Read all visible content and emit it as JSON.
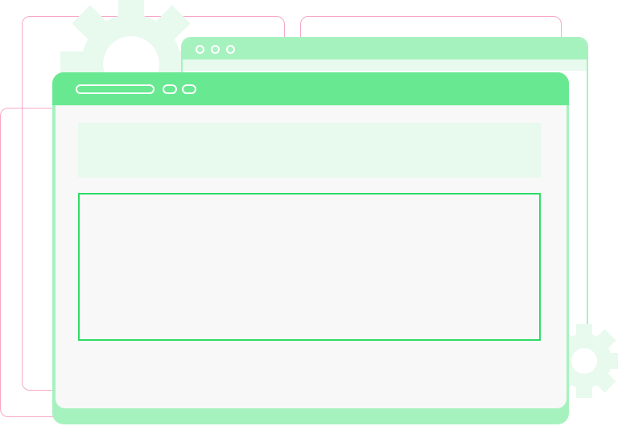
{
  "colors": {
    "header_primary": "#68e891",
    "header_secondary": "#a6f2bf",
    "banner": "#e8f9ee",
    "panel_border": "#2fdc66",
    "outline_pink": "#f7a8c8",
    "gear": "#e8f9ee"
  }
}
